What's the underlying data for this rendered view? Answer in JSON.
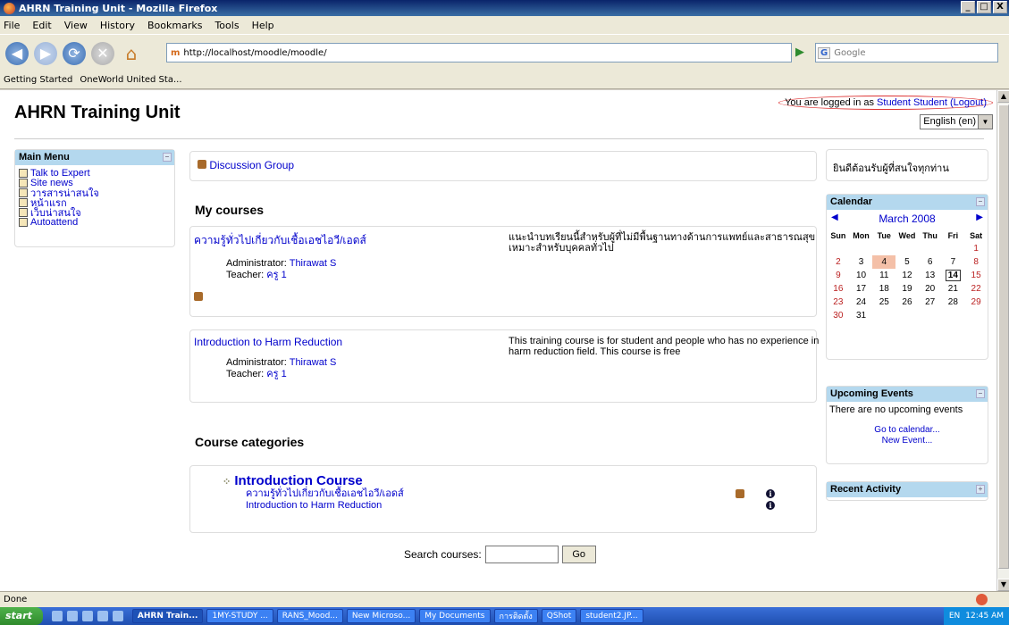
{
  "window": {
    "title": "AHRN Training Unit - Mozilla Firefox",
    "buttons": [
      "_",
      "□",
      "X"
    ]
  },
  "menubar": [
    "File",
    "Edit",
    "View",
    "History",
    "Bookmarks",
    "Tools",
    "Help"
  ],
  "navbar": {
    "url": "http://localhost/moodle/moodle/",
    "search_placeholder": "Google"
  },
  "bookmarks": [
    "Getting Started",
    "OneWorld United Sta..."
  ],
  "page": {
    "site_title": "AHRN Training Unit",
    "login_prefix": "You are logged in as ",
    "login_user": "Student Student",
    "logout": "(Logout)",
    "language": "English (en)"
  },
  "main_menu": {
    "title": "Main Menu",
    "items": [
      "Talk to Expert",
      "Site news",
      "วารสารน่าสนใจ",
      "หน้าแรก",
      "เว็บน่าสนใจ",
      "Autoattend"
    ]
  },
  "discussion": "Discussion Group",
  "my_courses": {
    "heading": "My courses",
    "courses": [
      {
        "name": "ความรู้ทั่วไปเกี่ยวกับเชื้อเอชไอวี/เอดส์",
        "admin_label": "Administrator:",
        "admin_name": "Thirawat S",
        "teacher_label": "Teacher:",
        "teacher_name": "ครู 1",
        "summary": "แนะนำบทเรียนนี้สำหรับผู้ที่ไม่มีพื้นฐานทางด้านการแพทย์และสาธารณสุข เหมาะสำหรับบุคคลทั่วไป"
      },
      {
        "name": "Introduction to Harm Reduction",
        "admin_label": "Administrator:",
        "admin_name": "Thirawat S",
        "teacher_label": "Teacher:",
        "teacher_name": "ครู 1",
        "summary": "This training course is for student and people who has no experience in harm reduction field. This course is free"
      }
    ]
  },
  "categories": {
    "heading": "Course categories",
    "category": "Introduction Course",
    "courses": [
      "ความรู้ทั่วไปเกี่ยวกับเชื้อเอชไอวี/เอดส์",
      "Introduction to Harm Reduction"
    ]
  },
  "search": {
    "label": "Search courses:",
    "button": "Go"
  },
  "welcome": "ยินดีต้อนรับผู้ที่สนใจทุกท่าน",
  "calendar": {
    "title": "Calendar",
    "month": "March 2008",
    "days": [
      "Sun",
      "Mon",
      "Tue",
      "Wed",
      "Thu",
      "Fri",
      "Sat"
    ],
    "weeks": [
      [
        "",
        "",
        "",
        "",
        "",
        "",
        "1"
      ],
      [
        "2",
        "3",
        "4",
        "5",
        "6",
        "7",
        "8"
      ],
      [
        "9",
        "10",
        "11",
        "12",
        "13",
        "14",
        "15"
      ],
      [
        "16",
        "17",
        "18",
        "19",
        "20",
        "21",
        "22"
      ],
      [
        "23",
        "24",
        "25",
        "26",
        "27",
        "28",
        "29"
      ],
      [
        "30",
        "31",
        "",
        "",
        "",
        "",
        ""
      ]
    ]
  },
  "upcoming": {
    "title": "Upcoming Events",
    "text": "There are no upcoming events",
    "go": "Go to calendar...",
    "new": "New Event..."
  },
  "recent": {
    "title": "Recent Activity"
  },
  "status": "Done",
  "taskbar": {
    "start": "start",
    "items": [
      "AHRN Train...",
      "1MY-STUDY ...",
      "RANS_Mood...",
      "New Microso...",
      "My Documents",
      "การติดตั้ง",
      "QShot",
      "student2.JP..."
    ],
    "lang": "EN",
    "time": "12:45 AM"
  }
}
